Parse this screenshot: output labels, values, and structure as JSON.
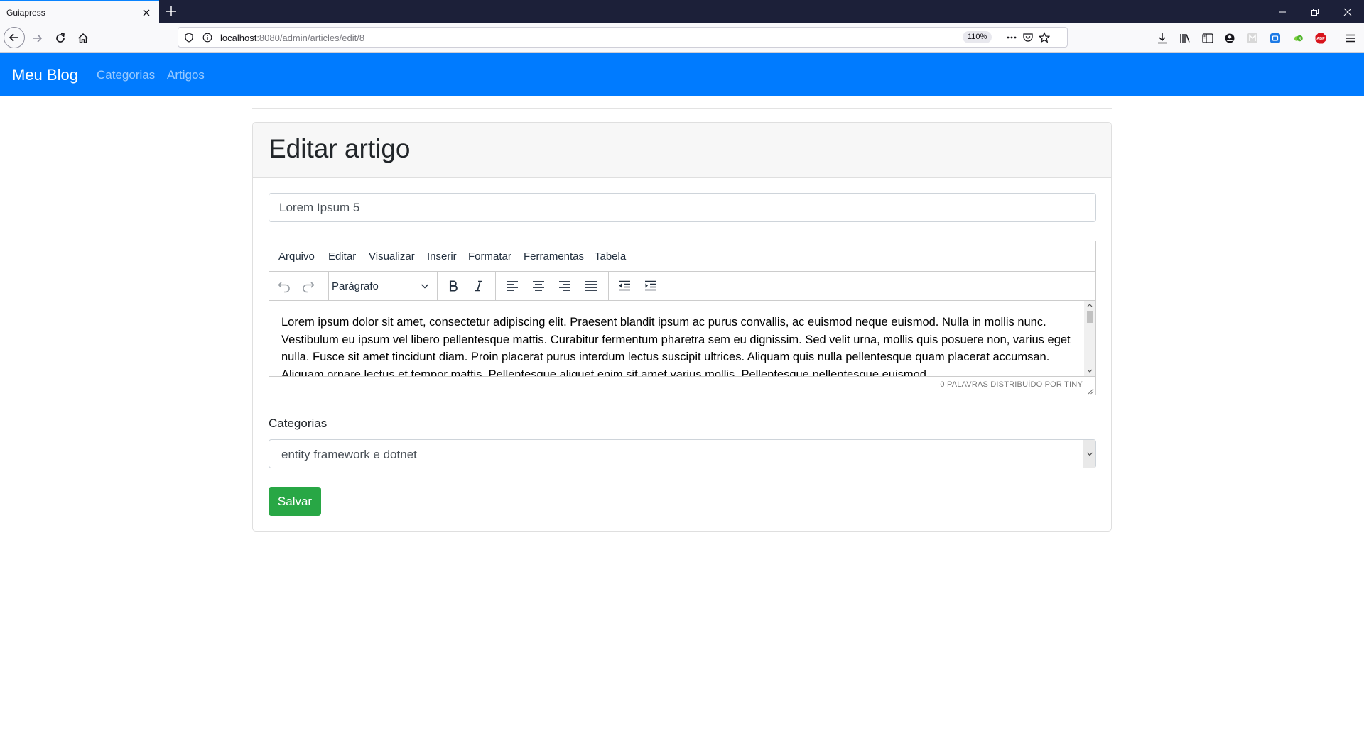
{
  "browser": {
    "tab_title": "Guiapress",
    "url_host": "localhost",
    "url_rest": ":8080/admin/articles/edit/8",
    "zoom": "110%"
  },
  "site": {
    "brand": "Meu Blog",
    "nav": [
      "Categorias",
      "Artigos"
    ],
    "accent": "#007bff"
  },
  "page": {
    "title": "Editar artigo",
    "article_title_value": "Lorem Ipsum 5",
    "editor": {
      "menu": [
        "Arquivo",
        "Editar",
        "Visualizar",
        "Inserir",
        "Formatar",
        "Ferramentas",
        "Tabela"
      ],
      "block_format": "Parágrafo",
      "content": "Lorem ipsum dolor sit amet, consectetur adipiscing elit. Praesent blandit ipsum ac purus convallis, ac euismod neque euismod. Nulla in mollis nunc. Vestibulum eu ipsum vel libero pellentesque mattis. Curabitur fermentum pharetra sem eu dignissim. Sed velit urna, mollis quis posuere non, varius eget nulla. Fusce sit amet tincidunt diam. Proin placerat purus interdum lectus suscipit ultrices. Aliquam quis nulla pellentesque quam placerat accumsan. Aliquam ornare lectus et tempor mattis. Pellentesque aliquet enim sit amet varius mollis. Pellentesque pellentesque euismod",
      "status": "0 PALAVRAS  DISTRIBUÍDO POR TINY"
    },
    "category_label": "Categorias",
    "category_selected": "entity framework e dotnet",
    "save_label": "Salvar",
    "save_color": "#28a745"
  }
}
